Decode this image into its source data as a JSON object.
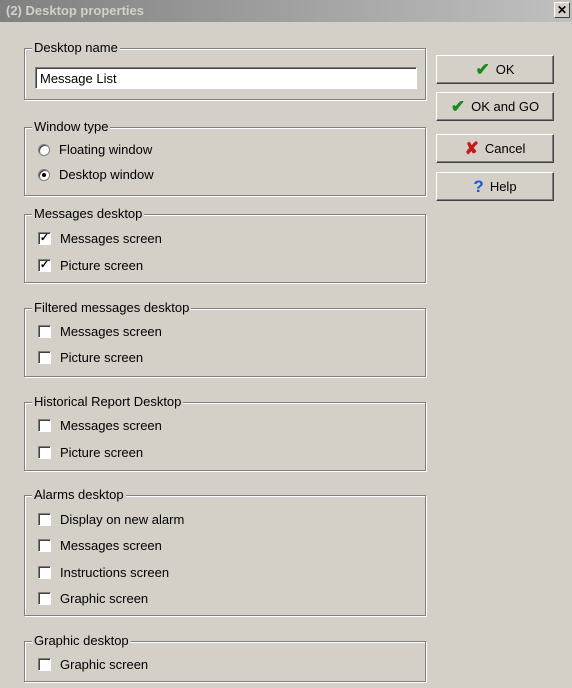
{
  "window": {
    "title": "(2)  Desktop properties",
    "close": "✕"
  },
  "desktop_name": {
    "legend": "Desktop name",
    "value": "Message List"
  },
  "window_type": {
    "legend": "Window type",
    "options": [
      {
        "label": "Floating window",
        "selected": false
      },
      {
        "label": "Desktop window",
        "selected": true
      }
    ]
  },
  "groups": {
    "messages": {
      "legend": "Messages desktop",
      "items": [
        {
          "label": "Messages screen",
          "checked": true
        },
        {
          "label": "Picture screen",
          "checked": true
        }
      ]
    },
    "filtered": {
      "legend": "Filtered messages desktop",
      "items": [
        {
          "label": "Messages screen",
          "checked": false
        },
        {
          "label": "Picture screen",
          "checked": false
        }
      ]
    },
    "historical": {
      "legend": "Historical Report Desktop",
      "items": [
        {
          "label": "Messages screen",
          "checked": false
        },
        {
          "label": "Picture screen",
          "checked": false
        }
      ]
    },
    "alarms": {
      "legend": "Alarms desktop",
      "items": [
        {
          "label": "Display on new alarm",
          "checked": false
        },
        {
          "label": "Messages screen",
          "checked": false
        },
        {
          "label": "Instructions screen",
          "checked": false
        },
        {
          "label": "Graphic screen",
          "checked": false
        }
      ]
    },
    "graphic": {
      "legend": "Graphic desktop",
      "items": [
        {
          "label": "Graphic screen",
          "checked": false
        }
      ]
    }
  },
  "buttons": {
    "ok": "OK",
    "ok_go": "OK and GO",
    "cancel": "Cancel",
    "help": "Help"
  },
  "glyphs": {
    "check": "✓",
    "ok_icon": "✔",
    "cancel_icon": "✘",
    "help_icon": "?"
  }
}
